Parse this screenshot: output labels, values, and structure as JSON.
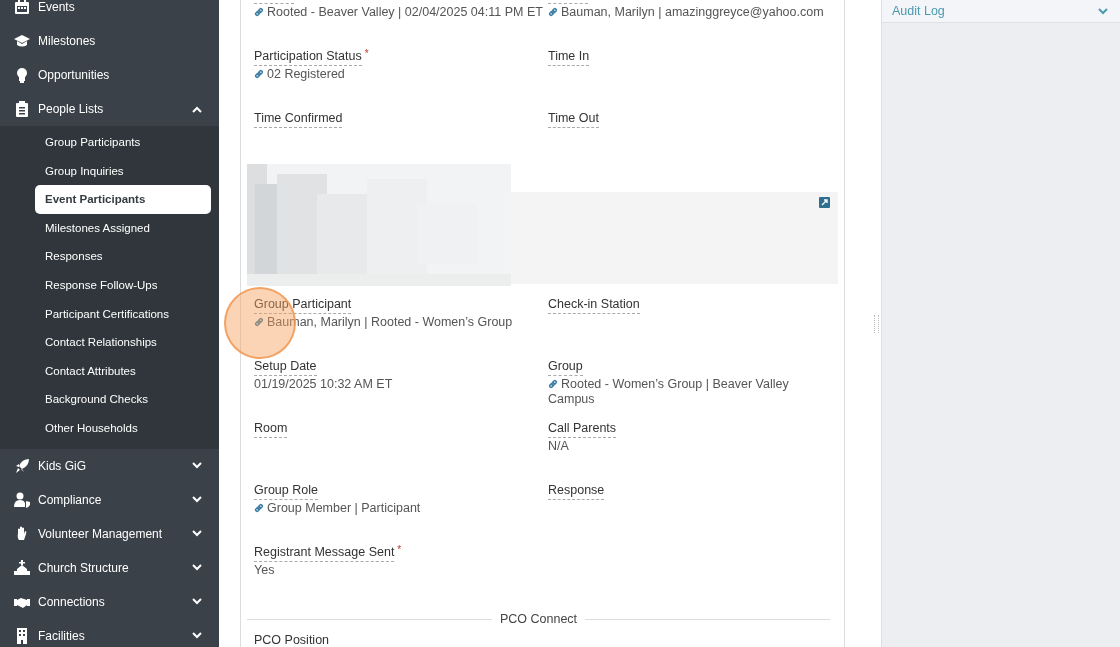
{
  "sidebar": {
    "items": [
      {
        "label": "Events",
        "kind": "link"
      },
      {
        "label": "Milestones",
        "kind": "link"
      },
      {
        "label": "Opportunities",
        "kind": "link"
      },
      {
        "label": "People Lists",
        "kind": "group",
        "expanded": true,
        "children": [
          {
            "label": "Group Participants",
            "selected": false
          },
          {
            "label": "Group Inquiries",
            "selected": false
          },
          {
            "label": "Event Participants",
            "selected": true
          },
          {
            "label": "Milestones Assigned",
            "selected": false
          },
          {
            "label": "Responses",
            "selected": false
          },
          {
            "label": "Response Follow-Ups",
            "selected": false
          },
          {
            "label": "Participant Certifications",
            "selected": false
          },
          {
            "label": "Contact Relationships",
            "selected": false
          },
          {
            "label": "Contact Attributes",
            "selected": false
          },
          {
            "label": "Background Checks",
            "selected": false
          },
          {
            "label": "Other Households",
            "selected": false
          }
        ]
      },
      {
        "label": "Kids GiG",
        "kind": "group",
        "expanded": false
      },
      {
        "label": "Compliance",
        "kind": "group",
        "expanded": false
      },
      {
        "label": "Volunteer Management",
        "kind": "group",
        "expanded": false
      },
      {
        "label": "Church Structure",
        "kind": "group",
        "expanded": false
      },
      {
        "label": "Connections",
        "kind": "group",
        "expanded": false
      },
      {
        "label": "Facilities",
        "kind": "group",
        "expanded": false
      }
    ]
  },
  "form": {
    "sections": [
      {
        "kind": "fields",
        "rows": [
          [
            {
              "value": "Rooted - Beaver Valley | 02/04/2025 04:11 PM ET",
              "link": true
            },
            {
              "value": "Bauman, Marilyn | amazinggreyce@yahoo.com",
              "link": true
            }
          ],
          [
            {
              "label": "Participation Status",
              "required_mark": "*",
              "value": "02 Registered",
              "link": true
            },
            {
              "label": "Time In"
            }
          ],
          [
            {
              "label": "Time Confirmed"
            },
            {
              "label": "Time Out"
            }
          ]
        ]
      },
      {
        "kind": "picture"
      },
      {
        "kind": "fields",
        "rows": [
          [
            {
              "label": "Group Participant",
              "value": "Bauman, Marilyn | Rooted - Women’s Group",
              "link": true
            },
            {
              "label": "Check-in Station"
            }
          ],
          [
            {
              "label": "Setup Date",
              "value": "01/19/2025 10:32 AM ET",
              "link": false
            },
            {
              "label": "Group",
              "value": "Rooted - Women’s Group | Beaver Valley Campus",
              "link": true
            }
          ],
          [
            {
              "label": "Room"
            },
            {
              "label": "Call Parents",
              "value": "N/A",
              "link": false
            }
          ],
          [
            {
              "label": "Group Role",
              "value": "Group Member | Participant",
              "link": true
            },
            {
              "label": "Response"
            }
          ],
          [
            {
              "label": "Registrant Message Sent",
              "required_mark": "*",
              "value": "Yes",
              "link": false
            }
          ]
        ]
      },
      {
        "kind": "divider",
        "title": "PCO Connect"
      },
      {
        "kind": "fields",
        "rows": [
          [
            {
              "label": "PCO Position"
            }
          ]
        ]
      }
    ]
  },
  "side_panel": {
    "title": "Audit Log",
    "expanded": false
  }
}
